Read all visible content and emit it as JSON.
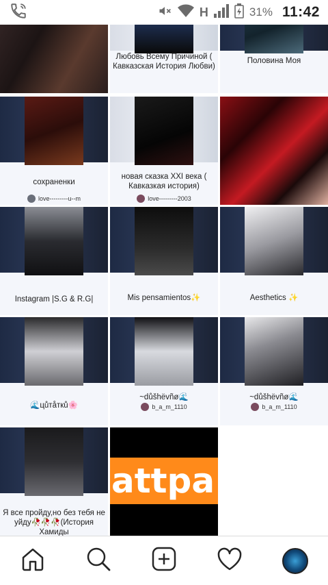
{
  "status_bar": {
    "network": "H",
    "battery": "31%",
    "time": "11:42"
  },
  "tiles": [
    {
      "title": "",
      "author": ""
    },
    {
      "title": "Любовь Всему Причиной ( Кавказская История Любви)",
      "author": ""
    },
    {
      "title": "Половина Моя",
      "author": ""
    },
    {
      "title": "сохраненки",
      "author": "love---------u--m"
    },
    {
      "title": "новая сказка  XXI века ( Кавказкая история)",
      "author": "love---------2003"
    },
    {
      "title": "",
      "author": ""
    },
    {
      "title": "Instagram |S.G & R.G|",
      "author": ""
    },
    {
      "title": "Mis pensamientos✨",
      "author": ""
    },
    {
      "title": "Aesthetics ✨",
      "author": ""
    },
    {
      "title": "🌊цůтåткů🌸",
      "author": ""
    },
    {
      "title": "~důšhëvñø🌊",
      "author": "b_a_m_1110"
    },
    {
      "title": "~důšhëvñø🌊",
      "author": "b_a_m_1110"
    },
    {
      "title": "Я все пройду,но без тебя не уйду🥀🥀🥀(История Хамиды",
      "author": ""
    }
  ],
  "wattpad_text": "attpa",
  "nav": {
    "home": "home-icon",
    "search": "search-icon",
    "add": "add-icon",
    "activity": "heart-icon",
    "profile": "profile-avatar"
  }
}
